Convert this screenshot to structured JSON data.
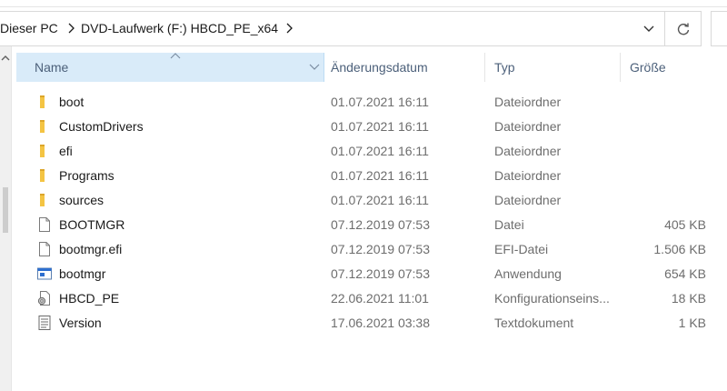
{
  "address": {
    "crumbs": [
      "Dieser PC",
      "DVD-Laufwerk (F:) HBCD_PE_x64"
    ]
  },
  "columns": {
    "name": "Name",
    "date": "Änderungsdatum",
    "type": "Typ",
    "size": "Größe"
  },
  "files": [
    {
      "name": "boot",
      "date": "01.07.2021 16:11",
      "type": "Dateiordner",
      "size": "",
      "icon": "folder-icon"
    },
    {
      "name": "CustomDrivers",
      "date": "01.07.2021 16:11",
      "type": "Dateiordner",
      "size": "",
      "icon": "folder-icon"
    },
    {
      "name": "efi",
      "date": "01.07.2021 16:11",
      "type": "Dateiordner",
      "size": "",
      "icon": "folder-icon"
    },
    {
      "name": "Programs",
      "date": "01.07.2021 16:11",
      "type": "Dateiordner",
      "size": "",
      "icon": "folder-icon"
    },
    {
      "name": "sources",
      "date": "01.07.2021 16:11",
      "type": "Dateiordner",
      "size": "",
      "icon": "folder-icon"
    },
    {
      "name": "BOOTMGR",
      "date": "07.12.2019 07:53",
      "type": "Datei",
      "size": "405 KB",
      "icon": "file-icon"
    },
    {
      "name": "bootmgr.efi",
      "date": "07.12.2019 07:53",
      "type": "EFI-Datei",
      "size": "1.506 KB",
      "icon": "file-icon"
    },
    {
      "name": "bootmgr",
      "date": "07.12.2019 07:53",
      "type": "Anwendung",
      "size": "654 KB",
      "icon": "application-icon"
    },
    {
      "name": "HBCD_PE",
      "date": "22.06.2021 11:01",
      "type": "Konfigurationseins...",
      "size": "18 KB",
      "icon": "config-file-icon"
    },
    {
      "name": "Version",
      "date": "17.06.2021 03:38",
      "type": "Textdokument",
      "size": "1 KB",
      "icon": "text-file-icon"
    }
  ],
  "colors": {
    "header_selected": "#d9ebf9",
    "folder": "#f4c443",
    "header_text": "#4c607a",
    "secondary_text": "#6d6d6d"
  }
}
